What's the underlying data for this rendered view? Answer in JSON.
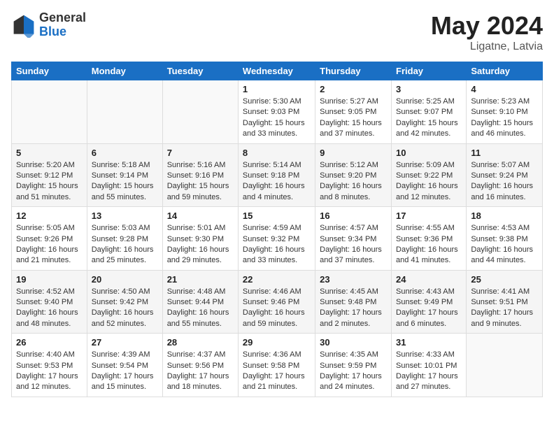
{
  "header": {
    "logo_general": "General",
    "logo_blue": "Blue",
    "month_year": "May 2024",
    "location": "Ligatne, Latvia"
  },
  "days_of_week": [
    "Sunday",
    "Monday",
    "Tuesday",
    "Wednesday",
    "Thursday",
    "Friday",
    "Saturday"
  ],
  "weeks": [
    [
      {
        "day": "",
        "info": ""
      },
      {
        "day": "",
        "info": ""
      },
      {
        "day": "",
        "info": ""
      },
      {
        "day": "1",
        "info": "Sunrise: 5:30 AM\nSunset: 9:03 PM\nDaylight: 15 hours\nand 33 minutes."
      },
      {
        "day": "2",
        "info": "Sunrise: 5:27 AM\nSunset: 9:05 PM\nDaylight: 15 hours\nand 37 minutes."
      },
      {
        "day": "3",
        "info": "Sunrise: 5:25 AM\nSunset: 9:07 PM\nDaylight: 15 hours\nand 42 minutes."
      },
      {
        "day": "4",
        "info": "Sunrise: 5:23 AM\nSunset: 9:10 PM\nDaylight: 15 hours\nand 46 minutes."
      }
    ],
    [
      {
        "day": "5",
        "info": "Sunrise: 5:20 AM\nSunset: 9:12 PM\nDaylight: 15 hours\nand 51 minutes."
      },
      {
        "day": "6",
        "info": "Sunrise: 5:18 AM\nSunset: 9:14 PM\nDaylight: 15 hours\nand 55 minutes."
      },
      {
        "day": "7",
        "info": "Sunrise: 5:16 AM\nSunset: 9:16 PM\nDaylight: 15 hours\nand 59 minutes."
      },
      {
        "day": "8",
        "info": "Sunrise: 5:14 AM\nSunset: 9:18 PM\nDaylight: 16 hours\nand 4 minutes."
      },
      {
        "day": "9",
        "info": "Sunrise: 5:12 AM\nSunset: 9:20 PM\nDaylight: 16 hours\nand 8 minutes."
      },
      {
        "day": "10",
        "info": "Sunrise: 5:09 AM\nSunset: 9:22 PM\nDaylight: 16 hours\nand 12 minutes."
      },
      {
        "day": "11",
        "info": "Sunrise: 5:07 AM\nSunset: 9:24 PM\nDaylight: 16 hours\nand 16 minutes."
      }
    ],
    [
      {
        "day": "12",
        "info": "Sunrise: 5:05 AM\nSunset: 9:26 PM\nDaylight: 16 hours\nand 21 minutes."
      },
      {
        "day": "13",
        "info": "Sunrise: 5:03 AM\nSunset: 9:28 PM\nDaylight: 16 hours\nand 25 minutes."
      },
      {
        "day": "14",
        "info": "Sunrise: 5:01 AM\nSunset: 9:30 PM\nDaylight: 16 hours\nand 29 minutes."
      },
      {
        "day": "15",
        "info": "Sunrise: 4:59 AM\nSunset: 9:32 PM\nDaylight: 16 hours\nand 33 minutes."
      },
      {
        "day": "16",
        "info": "Sunrise: 4:57 AM\nSunset: 9:34 PM\nDaylight: 16 hours\nand 37 minutes."
      },
      {
        "day": "17",
        "info": "Sunrise: 4:55 AM\nSunset: 9:36 PM\nDaylight: 16 hours\nand 41 minutes."
      },
      {
        "day": "18",
        "info": "Sunrise: 4:53 AM\nSunset: 9:38 PM\nDaylight: 16 hours\nand 44 minutes."
      }
    ],
    [
      {
        "day": "19",
        "info": "Sunrise: 4:52 AM\nSunset: 9:40 PM\nDaylight: 16 hours\nand 48 minutes."
      },
      {
        "day": "20",
        "info": "Sunrise: 4:50 AM\nSunset: 9:42 PM\nDaylight: 16 hours\nand 52 minutes."
      },
      {
        "day": "21",
        "info": "Sunrise: 4:48 AM\nSunset: 9:44 PM\nDaylight: 16 hours\nand 55 minutes."
      },
      {
        "day": "22",
        "info": "Sunrise: 4:46 AM\nSunset: 9:46 PM\nDaylight: 16 hours\nand 59 minutes."
      },
      {
        "day": "23",
        "info": "Sunrise: 4:45 AM\nSunset: 9:48 PM\nDaylight: 17 hours\nand 2 minutes."
      },
      {
        "day": "24",
        "info": "Sunrise: 4:43 AM\nSunset: 9:49 PM\nDaylight: 17 hours\nand 6 minutes."
      },
      {
        "day": "25",
        "info": "Sunrise: 4:41 AM\nSunset: 9:51 PM\nDaylight: 17 hours\nand 9 minutes."
      }
    ],
    [
      {
        "day": "26",
        "info": "Sunrise: 4:40 AM\nSunset: 9:53 PM\nDaylight: 17 hours\nand 12 minutes."
      },
      {
        "day": "27",
        "info": "Sunrise: 4:39 AM\nSunset: 9:54 PM\nDaylight: 17 hours\nand 15 minutes."
      },
      {
        "day": "28",
        "info": "Sunrise: 4:37 AM\nSunset: 9:56 PM\nDaylight: 17 hours\nand 18 minutes."
      },
      {
        "day": "29",
        "info": "Sunrise: 4:36 AM\nSunset: 9:58 PM\nDaylight: 17 hours\nand 21 minutes."
      },
      {
        "day": "30",
        "info": "Sunrise: 4:35 AM\nSunset: 9:59 PM\nDaylight: 17 hours\nand 24 minutes."
      },
      {
        "day": "31",
        "info": "Sunrise: 4:33 AM\nSunset: 10:01 PM\nDaylight: 17 hours\nand 27 minutes."
      },
      {
        "day": "",
        "info": ""
      }
    ]
  ]
}
